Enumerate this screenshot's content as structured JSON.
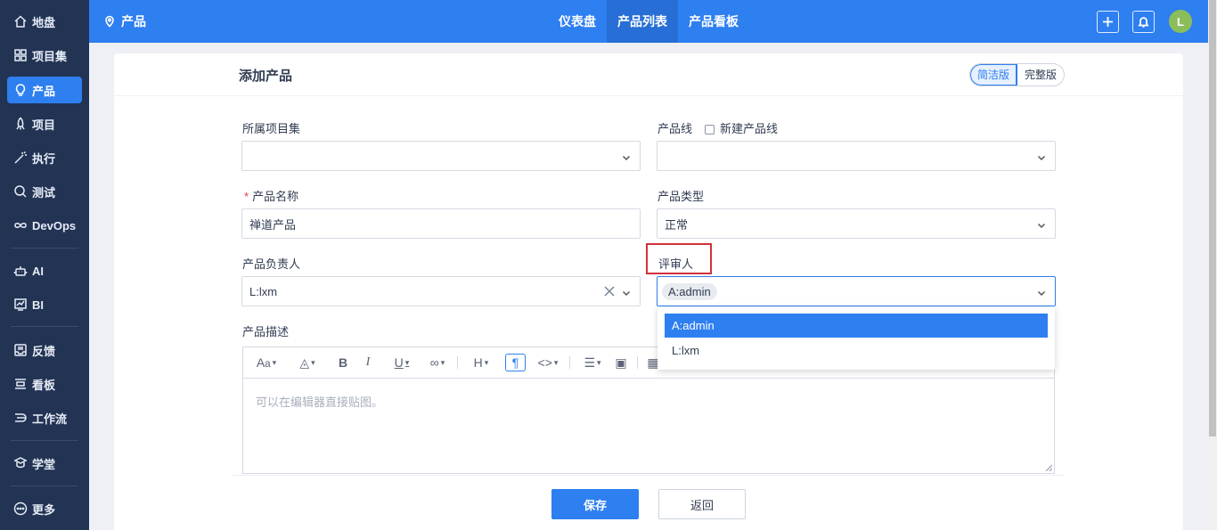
{
  "sidebar": {
    "items": [
      {
        "label": "地盘",
        "icon": "home-icon"
      },
      {
        "label": "项目集",
        "icon": "grid-icon"
      },
      {
        "label": "产品",
        "icon": "lightbulb-icon",
        "active": true
      },
      {
        "label": "项目",
        "icon": "rocket-icon"
      },
      {
        "label": "执行",
        "icon": "wand-icon"
      },
      {
        "label": "测试",
        "icon": "search-check-icon"
      },
      {
        "label": "DevOps",
        "icon": "infinity-icon"
      },
      {
        "label": "AI",
        "icon": "robot-icon"
      },
      {
        "label": "BI",
        "icon": "chart-icon"
      },
      {
        "label": "反馈",
        "icon": "inbox-icon"
      },
      {
        "label": "看板",
        "icon": "board-icon"
      },
      {
        "label": "工作流",
        "icon": "workflow-icon"
      },
      {
        "label": "学堂",
        "icon": "school-icon"
      },
      {
        "label": "更多",
        "icon": "more-icon"
      }
    ]
  },
  "topbar": {
    "title": "产品",
    "tabs": [
      {
        "label": "仪表盘"
      },
      {
        "label": "产品列表",
        "active": true
      },
      {
        "label": "产品看板"
      }
    ],
    "avatar": "L"
  },
  "page": {
    "title": "添加产品",
    "mode_simple": "简洁版",
    "mode_full": "完整版"
  },
  "form": {
    "program_label": "所属项目集",
    "program_value": "",
    "line_label": "产品线",
    "new_line_label": "新建产品线",
    "line_value": "",
    "name_label": "产品名称",
    "name_value": "禅道产品",
    "type_label": "产品类型",
    "type_value": "正常",
    "owner_label": "产品负责人",
    "owner_value": "L:lxm",
    "reviewer_label": "评审人",
    "reviewer_chip": "A:admin",
    "desc_label": "产品描述",
    "desc_placeholder": "可以在编辑器直接贴图。"
  },
  "dropdown": {
    "options": [
      "A:admin",
      "L:lxm"
    ],
    "selected": "A:admin"
  },
  "actions": {
    "save": "保存",
    "back": "返回"
  },
  "colors": {
    "accent": "#2e7ff0",
    "sidebar": "#223354",
    "highlight": "#d1323b"
  }
}
